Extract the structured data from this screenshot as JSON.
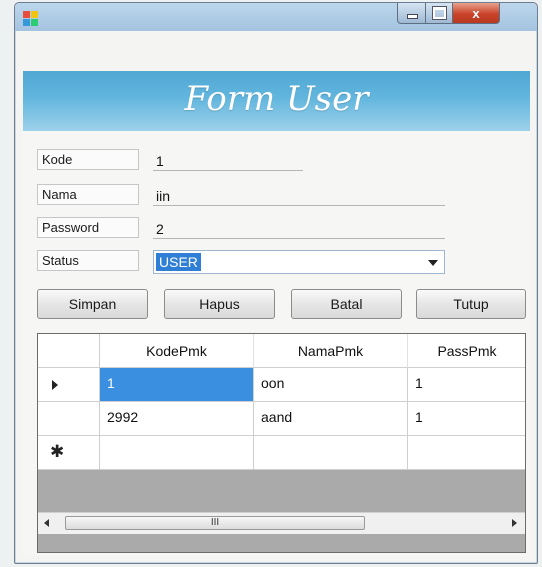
{
  "window": {
    "title_bar": {
      "min_glyph": "minimize-icon",
      "max_glyph": "maximize-icon",
      "close_label": "x"
    }
  },
  "form": {
    "title": "Form User",
    "fields": {
      "kode": {
        "label": "Kode",
        "value": "1"
      },
      "nama": {
        "label": "Nama",
        "value": "iin"
      },
      "password": {
        "label": "Password",
        "value": "2"
      },
      "status": {
        "label": "Status",
        "value": "USER"
      }
    },
    "buttons": {
      "simpan": "Simpan",
      "hapus": "Hapus",
      "batal": "Batal",
      "tutup": "Tutup"
    }
  },
  "grid": {
    "columns": [
      "KodePmk",
      "NamaPmk",
      "PassPmk"
    ],
    "rows": [
      {
        "KodePmk": "1",
        "NamaPmk": "oon",
        "PassPmk": "1"
      },
      {
        "KodePmk": "2992",
        "NamaPmk": "aand",
        "PassPmk": "1"
      }
    ],
    "new_row_marker": "✱",
    "scroll_thumb_label": "III"
  },
  "colors": {
    "header_band": "#62b6de",
    "selection": "#3a8fe0",
    "close_button": "#c8432a"
  }
}
